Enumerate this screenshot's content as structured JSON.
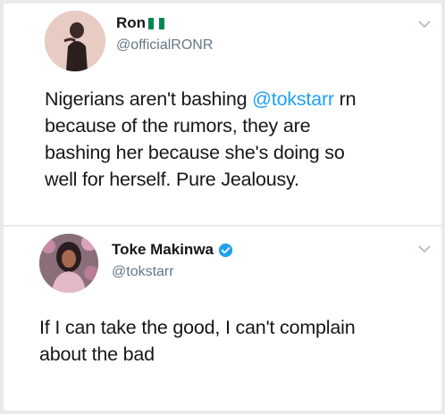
{
  "tweet1": {
    "display_name": "Ron",
    "handle": "@officialRONR",
    "text_lines": [
      {
        "before": "Nigerians aren't bashing ",
        "mention": "@tokstarr",
        "after": " rn"
      },
      {
        "before": "because of the rumors,  they are",
        "mention": "",
        "after": ""
      },
      {
        "before": "bashing her because she's doing so",
        "mention": "",
        "after": ""
      },
      {
        "before": "well for herself.  Pure Jealousy.",
        "mention": "",
        "after": ""
      }
    ],
    "flag_icon": "nigeria-flag-icon",
    "flag_colors": [
      "#008751",
      "#ffffff",
      "#008751"
    ]
  },
  "tweet2": {
    "display_name": "Toke Makinwa",
    "handle": "@tokstarr",
    "verified": true,
    "text_lines": [
      "If I can take the good, I can't complain",
      "about the bad"
    ]
  },
  "colors": {
    "mention": "#1da1f2",
    "handle": "#657786",
    "verified": "#1da1f2",
    "chevron": "#aab8c2"
  }
}
